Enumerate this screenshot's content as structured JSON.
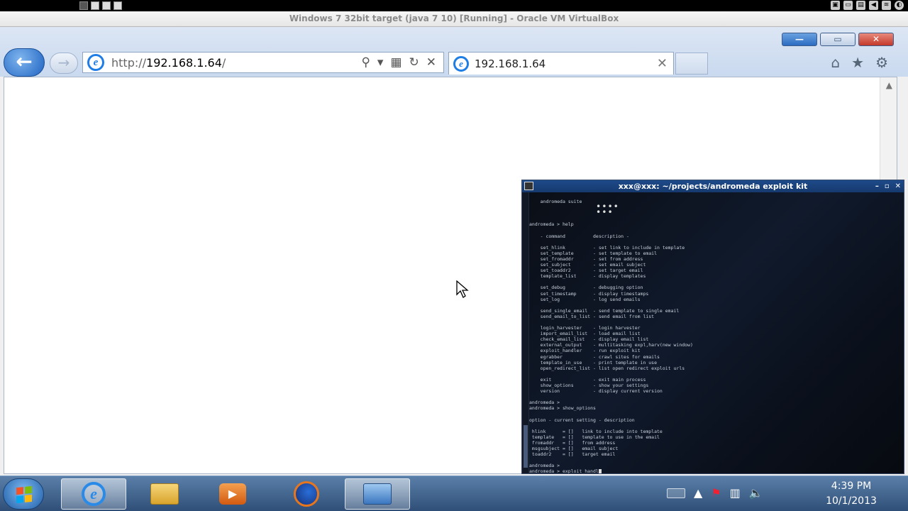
{
  "vm_window": {
    "title": "Windows 7 32bit target (java 7 10) [Running] - Oracle VM VirtualBox"
  },
  "ie": {
    "address": {
      "url_prefix": "http://",
      "url_host": "192.168.1.64",
      "url_suffix": "/"
    },
    "tab": {
      "title": "192.168.1.64"
    },
    "window_buttons": {
      "minimize": "—",
      "maximize": "▭",
      "close": "✕"
    }
  },
  "terminal": {
    "title": "xxx@xxx: ~/projects/andromeda exploit kit",
    "lines": [
      "    andromeda suite",
      "",
      "",
      "",
      "andromeda > help",
      "",
      "    - command          description -",
      "",
      "    set_hlink          - set link to include in template",
      "    set_template       - set template to email",
      "    set_fromaddr       - set from address",
      "    set_subject        - set email subject",
      "    set_toaddr2        - set target email",
      "    template_list      - display templates",
      "",
      "    set_debug          - debugging option",
      "    set_timestamp      - display timestamps",
      "    set_log            - log send emails",
      "",
      "    send_single_email  - send template to single email",
      "    send_email_to_list - send email from list",
      "",
      "    login_harvester    - login harvester",
      "    import_email_list  - load email list",
      "    check_email_list   - display email list",
      "    external_output    - multitasking expl,harv(new window)",
      "    exploit_handler    - run exploit kit",
      "    egrabber           - crawl sites for emails",
      "    template_in_use    - print template in use",
      "    open_redirect_list - list open redirect exploit urls",
      "",
      "    exit               - exit main process",
      "    show_options       - show your settings",
      "    version            - display current version",
      "",
      "andromeda >",
      "andromeda > show_options",
      "",
      "option - current setting - description",
      "",
      " hlink      = []   link to include into template",
      " template   = []   template to use in the email",
      " fromaddr   = []   from address",
      " msgsubject = []   email subject",
      " toaddr2    = []   target email",
      "",
      "andromeda >"
    ],
    "prompt_line": "andromeda > exploit_handl"
  },
  "taskbar": {
    "clock_time": "4:39 PM",
    "clock_date": "10/1/2013"
  }
}
